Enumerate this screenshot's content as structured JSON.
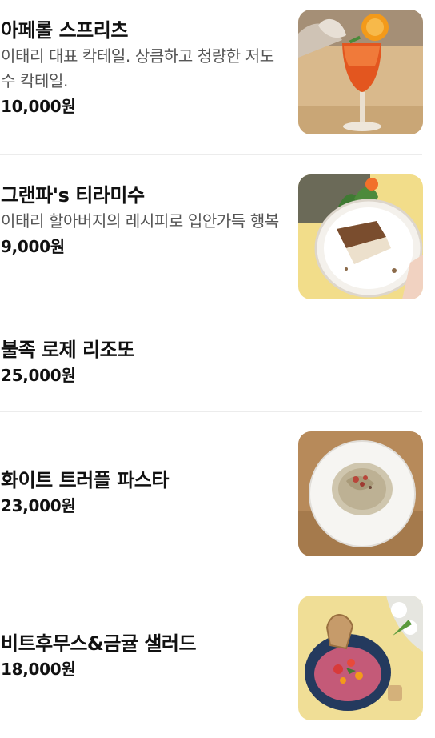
{
  "menu": {
    "items": [
      {
        "name": "아페롤 스프리츠",
        "description": "이태리 대표 칵테일. 상큼하고 청량한 저도수 칵테일.",
        "price": "10,000원",
        "image": "aperol-spritz-photo"
      },
      {
        "name": "그랜파's 티라미수",
        "description": "이태리 할아버지의 레시피로 입안가득 행복",
        "price": "9,000원",
        "image": "tiramisu-photo"
      },
      {
        "name": "불족 로제 리조또",
        "price": "25,000원"
      },
      {
        "name": "화이트 트러플 파스타",
        "price": "23,000원",
        "image": "truffle-pasta-photo"
      },
      {
        "name": "비트후무스&금귤 샐러드",
        "price": "18,000원",
        "image": "beet-hummus-salad-photo"
      }
    ]
  }
}
